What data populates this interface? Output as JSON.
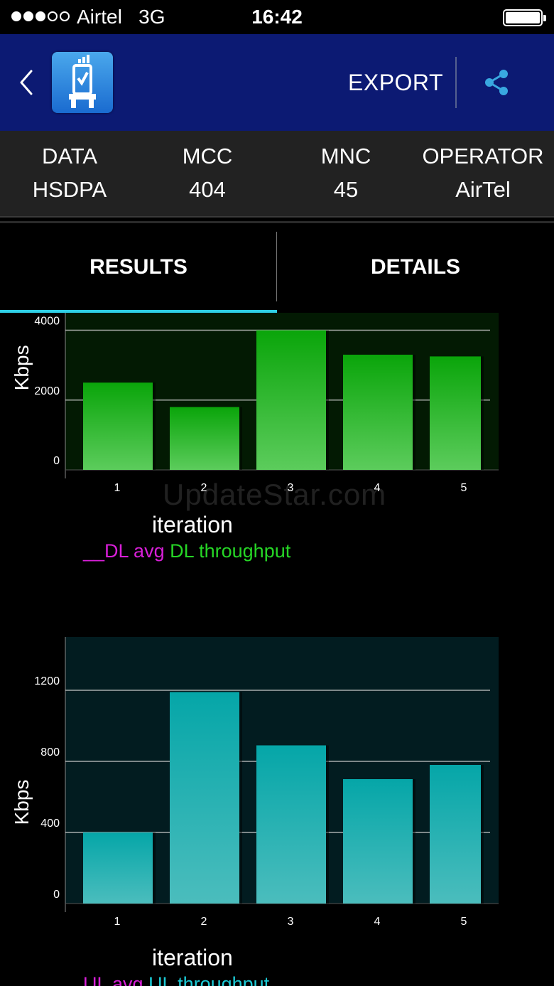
{
  "status_bar": {
    "carrier": "Airtel   3G",
    "time": "16:42",
    "signal_bars_filled": 3,
    "signal_bars_total": 5
  },
  "header": {
    "export_label": "EXPORT",
    "icons": [
      "chevron-left-icon",
      "app-logo-icon",
      "share-icon"
    ],
    "background_color": "#0c1a73"
  },
  "network_info": [
    {
      "label": "DATA",
      "value": "HSDPA"
    },
    {
      "label": "MCC",
      "value": "404"
    },
    {
      "label": "MNC",
      "value": "45"
    },
    {
      "label": "OPERATOR",
      "value": "AirTel"
    }
  ],
  "tabs": [
    {
      "label": "RESULTS",
      "active": true
    },
    {
      "label": "DETAILS",
      "active": false
    }
  ],
  "watermark": "UpdateStar.com",
  "chart_data": [
    {
      "type": "bar",
      "categories": [
        "1",
        "2",
        "3",
        "4",
        "5"
      ],
      "values": [
        2500,
        1800,
        4000,
        3300,
        3250
      ],
      "yticks": [
        0,
        2000,
        4000
      ],
      "ylim": [
        0,
        4500
      ],
      "xlabel": "iteration",
      "ylabel": "Kbps",
      "legend": [
        {
          "text": "__DL avg",
          "color": "#d81fd8"
        },
        {
          "text": "DL throughput",
          "color": "#26d626"
        }
      ],
      "bar_color_top": "#0aa50a",
      "bar_color_bottom": "#5ccc5c",
      "plot_bg": "#031a03",
      "grid": true
    },
    {
      "type": "bar",
      "categories": [
        "1",
        "2",
        "3",
        "4",
        "5"
      ],
      "values": [
        400,
        1190,
        890,
        700,
        780
      ],
      "yticks": [
        0,
        400,
        800,
        1200
      ],
      "ylim": [
        0,
        1500
      ],
      "xlabel": "iteration",
      "ylabel": "Kbps",
      "legend": [
        {
          "text": "UL avg",
          "color": "#d81fd8"
        },
        {
          "text": "UL throughput",
          "color": "#1ccbd6"
        }
      ],
      "bar_color_top": "#05a6a8",
      "bar_color_bottom": "#4bbdbd",
      "plot_bg": "#021c20",
      "grid": true
    }
  ]
}
